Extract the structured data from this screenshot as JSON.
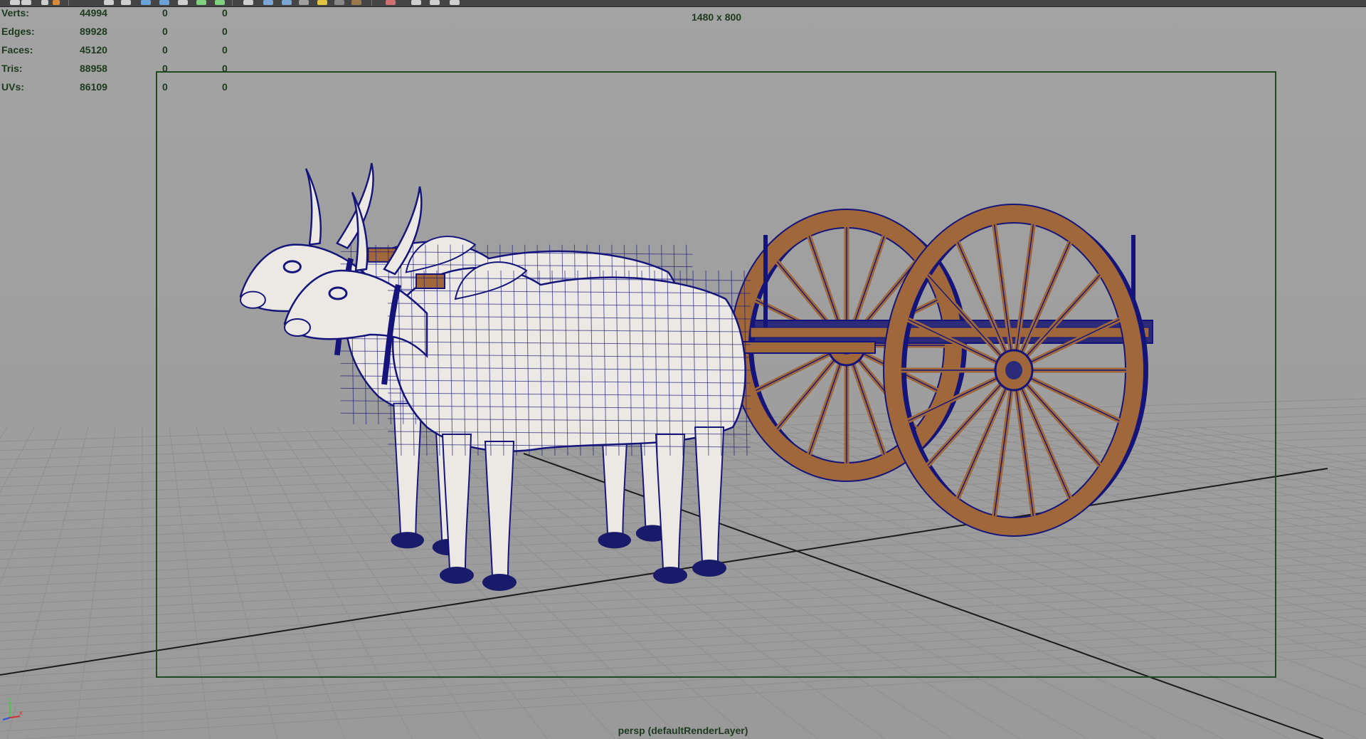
{
  "toolbar": {
    "icon_count": 22
  },
  "hud": {
    "rows": [
      {
        "label": "Verts:",
        "value": "44994",
        "selected": "0",
        "selected_alt": "0"
      },
      {
        "label": "Edges:",
        "value": "89928",
        "selected": "0",
        "selected_alt": "0"
      },
      {
        "label": "Faces:",
        "value": "45120",
        "selected": "0",
        "selected_alt": "0"
      },
      {
        "label": "Tris:",
        "value": "88958",
        "selected": "0",
        "selected_alt": "0"
      },
      {
        "label": "UVs:",
        "value": "86109",
        "selected": "0",
        "selected_alt": "0"
      }
    ]
  },
  "viewport": {
    "resolution": "1480 x 800",
    "camera": "persp (defaultRenderLayer)",
    "wire_color": "#14147a",
    "body_color": "#ece9e4",
    "wood_color": "#a0683a",
    "grid_color": "#8f8f8f",
    "gate_color": "#1f4a1f"
  },
  "axis_gizmo": {
    "x_label": "x",
    "y_label": "y"
  }
}
